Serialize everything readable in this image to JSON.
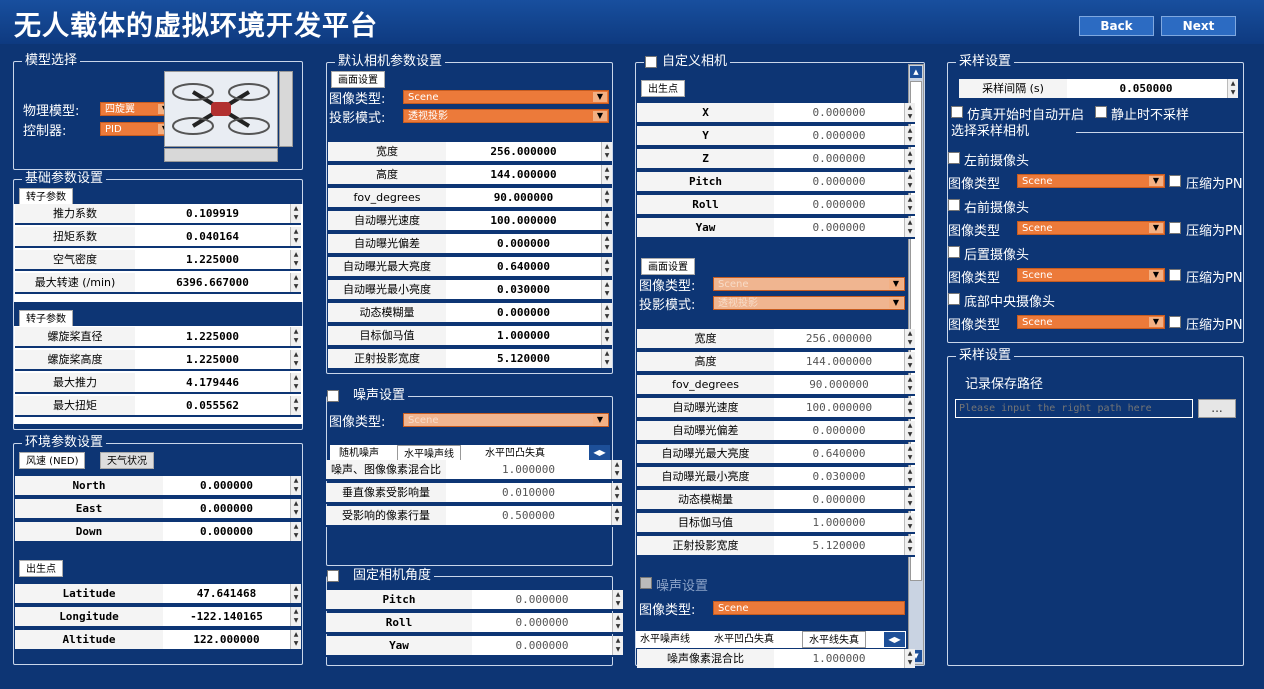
{
  "header": {
    "title": "无人载体的虚拟环境开发平台",
    "back": "Back",
    "next": "Next"
  },
  "model": {
    "title": "模型选择",
    "physics_label": "物理模型:",
    "physics_value": "四旋翼",
    "controller_label": "控制器:",
    "controller_value": "PID"
  },
  "basic": {
    "title": "基础参数设置",
    "tab1": "转子参数",
    "rows1": [
      {
        "label": "推力系数",
        "value": "0.109919"
      },
      {
        "label": "扭矩系数",
        "value": "0.040164"
      },
      {
        "label": "空气密度",
        "value": "1.225000"
      },
      {
        "label": "最大转速 (/min)",
        "value": "6396.667000"
      }
    ],
    "tab2": "转子参数",
    "rows2": [
      {
        "label": "螺旋桨直径",
        "value": "1.225000"
      },
      {
        "label": "螺旋桨高度",
        "value": "1.225000"
      },
      {
        "label": "最大推力",
        "value": "4.179446"
      },
      {
        "label": "最大扭矩",
        "value": "0.055562"
      }
    ]
  },
  "env": {
    "title": "环境参数设置",
    "tab_wind": "风速 (NED)",
    "tab_weather": "天气状况",
    "wind": [
      {
        "label": "North",
        "value": "0.000000"
      },
      {
        "label": "East",
        "value": "0.000000"
      },
      {
        "label": "Down",
        "value": "0.000000"
      }
    ],
    "tab_origin": "出生点",
    "origin": [
      {
        "label": "Latitude",
        "value": "47.641468"
      },
      {
        "label": "Longitude",
        "value": "-122.140165"
      },
      {
        "label": "Altitude",
        "value": "122.000000"
      }
    ]
  },
  "defcam": {
    "title": "默认相机参数设置",
    "tab": "画面设置",
    "image_type_label": "图像类型:",
    "image_type": "Scene",
    "proj_label": "投影模式:",
    "proj": "透视投影",
    "rows": [
      {
        "label": "宽度",
        "value": "256.000000"
      },
      {
        "label": "高度",
        "value": "144.000000"
      },
      {
        "label": "fov_degrees",
        "value": "90.000000"
      },
      {
        "label": "自动曝光速度",
        "value": "100.000000"
      },
      {
        "label": "自动曝光偏差",
        "value": "0.000000"
      },
      {
        "label": "自动曝光最大亮度",
        "value": "0.640000"
      },
      {
        "label": "自动曝光最小亮度",
        "value": "0.030000"
      },
      {
        "label": "动态模糊量",
        "value": "0.000000"
      },
      {
        "label": "目标伽马值",
        "value": "1.000000"
      },
      {
        "label": "正射投影宽度",
        "value": "5.120000"
      }
    ]
  },
  "noise": {
    "title": "噪声设置",
    "image_type_label": "图像类型:",
    "image_type": "Scene",
    "tabs": [
      "随机噪声",
      "水平噪声线",
      "水平凹凸失真"
    ],
    "rows": [
      {
        "label": "噪声、图像像素混合比",
        "value": "1.000000"
      },
      {
        "label": "垂直像素受影响量",
        "value": "0.010000"
      },
      {
        "label": "受影响的像素行量",
        "value": "0.500000"
      }
    ]
  },
  "fixcam": {
    "title": "固定相机角度",
    "rows": [
      {
        "label": "Pitch",
        "value": "0.000000"
      },
      {
        "label": "Roll",
        "value": "0.000000"
      },
      {
        "label": "Yaw",
        "value": "0.000000"
      }
    ]
  },
  "custom": {
    "title": "自定义相机",
    "tab_origin": "出生点",
    "pos": [
      {
        "label": "X",
        "value": "0.000000"
      },
      {
        "label": "Y",
        "value": "0.000000"
      },
      {
        "label": "Z",
        "value": "0.000000"
      },
      {
        "label": "Pitch",
        "value": "0.000000"
      },
      {
        "label": "Roll",
        "value": "0.000000"
      },
      {
        "label": "Yaw",
        "value": "0.000000"
      }
    ],
    "tab_screen": "画面设置",
    "image_type_label": "图像类型:",
    "image_type": "Scene",
    "proj_label": "投影模式:",
    "proj": "透视投影",
    "rows": [
      {
        "label": "宽度",
        "value": "256.000000"
      },
      {
        "label": "高度",
        "value": "144.000000"
      },
      {
        "label": "fov_degrees",
        "value": "90.000000"
      },
      {
        "label": "自动曝光速度",
        "value": "100.000000"
      },
      {
        "label": "自动曝光偏差",
        "value": "0.000000"
      },
      {
        "label": "自动曝光最大亮度",
        "value": "0.640000"
      },
      {
        "label": "自动曝光最小亮度",
        "value": "0.030000"
      },
      {
        "label": "动态模糊量",
        "value": "0.000000"
      },
      {
        "label": "目标伽马值",
        "value": "1.000000"
      },
      {
        "label": "正射投影宽度",
        "value": "5.120000"
      }
    ],
    "noise_title": "噪声设置",
    "noise_type_label": "图像类型:",
    "noise_type": "Scene",
    "noise_tabs": [
      "水平噪声线",
      "水平凹凸失真",
      "水平线失真"
    ],
    "noise_row": {
      "label": "噪声像素混合比",
      "value": "1.000000"
    }
  },
  "sampling": {
    "title": "采样设置",
    "interval_label": "采样间隔 (s)",
    "interval": "0.050000",
    "auto_start": "仿真开始时自动开启",
    "no_sample_static": "静止时不采样",
    "select_title": "选择采样相机",
    "cams": [
      {
        "name": "左前摄像头",
        "type_label": "图像类型",
        "type": "Scene",
        "compress": "压缩为PN"
      },
      {
        "name": "右前摄像头",
        "type_label": "图像类型",
        "type": "Scene",
        "compress": "压缩为PN"
      },
      {
        "name": "后置摄像头",
        "type_label": "图像类型",
        "type": "Scene",
        "compress": "压缩为PN"
      },
      {
        "name": "底部中央摄像头",
        "type_label": "图像类型",
        "type": "Scene",
        "compress": "压缩为PN"
      }
    ]
  },
  "save": {
    "title": "采样设置",
    "path_label": "记录保存路径",
    "placeholder": "Please input the right path here",
    "browse": "..."
  }
}
